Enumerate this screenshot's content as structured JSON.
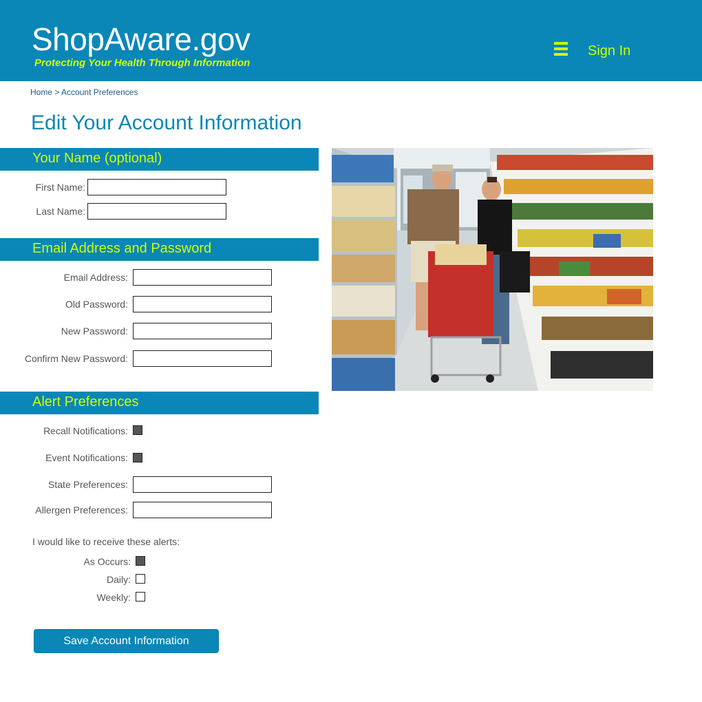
{
  "header": {
    "site_title": "ShopAware.gov",
    "tagline": "Protecting Your Health Through Information",
    "menu_icon": "hamburger-menu-icon",
    "sign_in": "Sign In"
  },
  "breadcrumb": {
    "home": "Home",
    "separator": ">",
    "current": "Account Preferences"
  },
  "page_title": "Edit Your Account Information",
  "sections": {
    "name": {
      "title": "Your Name (optional)",
      "first_name_label": "First Name:",
      "first_name_value": "",
      "last_name_label": "Last Name:",
      "last_name_value": ""
    },
    "email_password": {
      "title": "Email Address and Password",
      "email_label": "Email Address:",
      "old_password_label": "Old Password:",
      "new_password_label": "New Password:",
      "confirm_password_label": "Confirm New Password:"
    },
    "alerts": {
      "title": "Alert Preferences",
      "recall_label": "Recall Notifications:",
      "recall_checked": true,
      "event_label": "Event Notifications:",
      "event_checked": true,
      "state_label": "State Preferences:",
      "allergen_label": "Allergen Preferences:",
      "receive_intro": "I would like to receive these alerts:",
      "as_occurs_label": "As Occurs:",
      "as_occurs_checked": true,
      "daily_label": "Daily:",
      "daily_checked": false,
      "weekly_label": "Weekly:",
      "weekly_checked": false
    }
  },
  "save_button": "Save Account Information",
  "colors": {
    "brand_blue": "#0a87b7",
    "accent_lime": "#ccff00"
  }
}
